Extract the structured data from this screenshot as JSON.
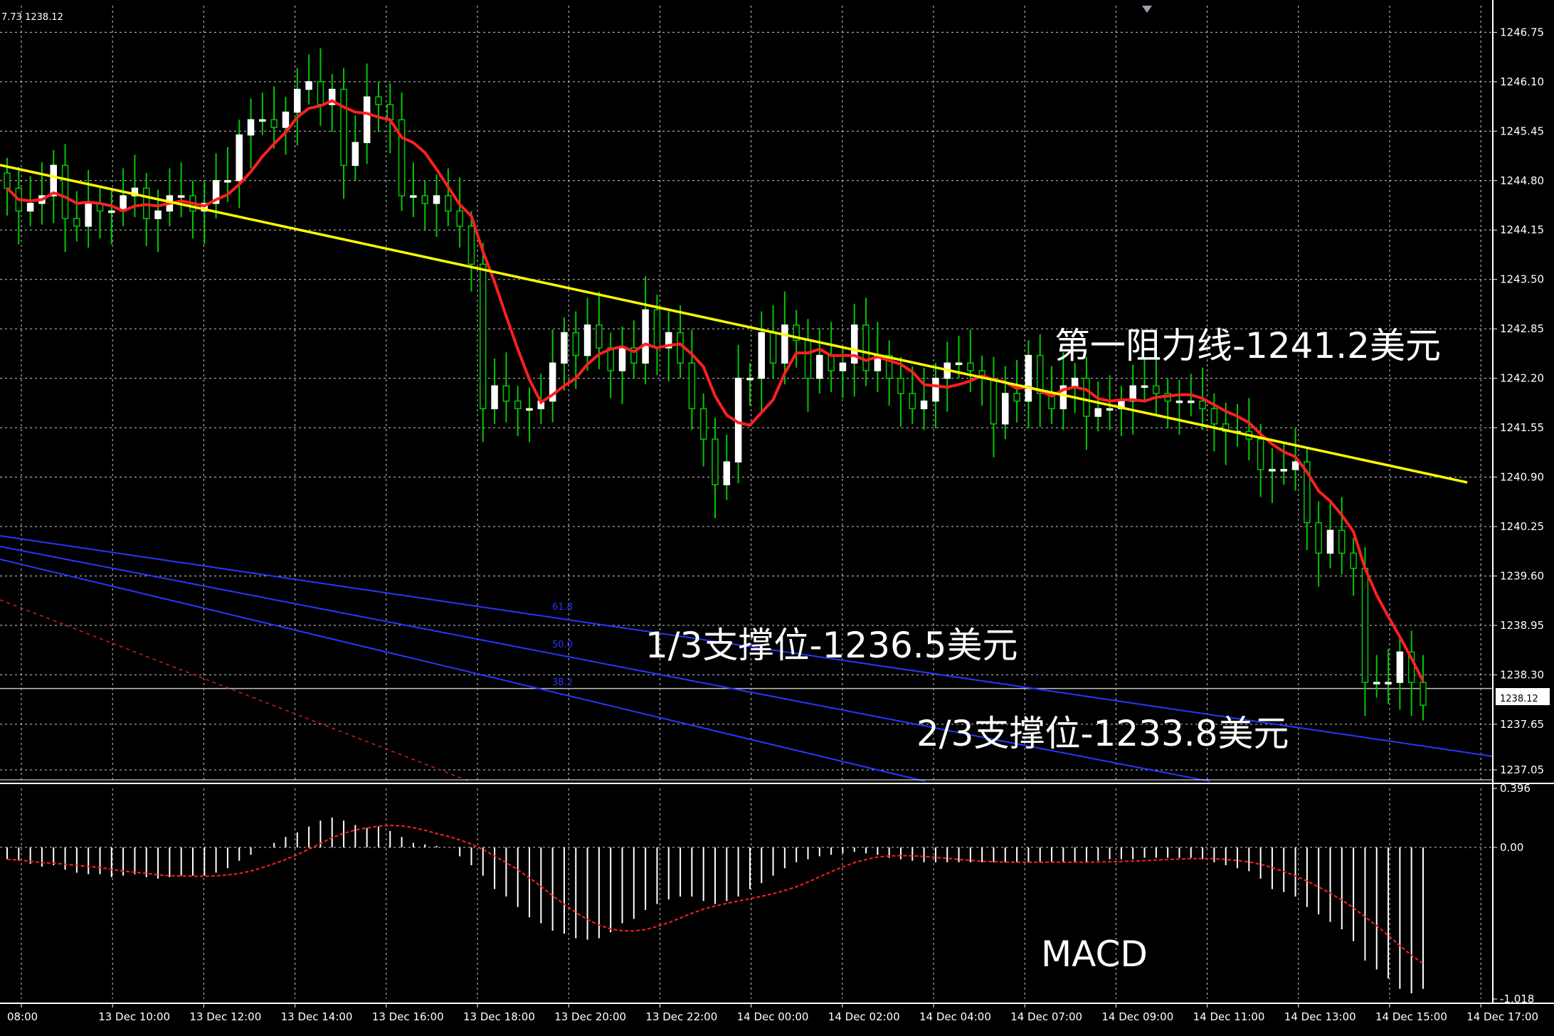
{
  "header": {
    "ohlc_text": "7.73 1238.12"
  },
  "colors": {
    "background": "#000000",
    "grid": "#ffffff",
    "bull_candle": "#ffffff",
    "wick": "#00c800",
    "ma_line": "#ff2020",
    "trend_line": "#ffff00",
    "fib_lines": "#2a36ff",
    "macd_hist": "#ffffff",
    "macd_signal": "#ff2020"
  },
  "annotations": {
    "resistance": "第一阻力线-1241.2美元",
    "support1": "1/3支撑位-1236.5美元",
    "support2": "2/3支撑位-1233.8美元",
    "macd": "MACD"
  },
  "fib_labels": [
    "61.8",
    "50.0",
    "38.2"
  ],
  "current_price_label": "1238.12",
  "chart_data": [
    {
      "type": "candlestick",
      "title": "",
      "price_axis_ticks": [
        "1246.75",
        "1246.10",
        "1245.45",
        "1244.80",
        "1244.15",
        "1243.50",
        "1242.85",
        "1242.20",
        "1241.55",
        "1240.90",
        "1240.25",
        "1239.60",
        "1238.95",
        "1238.30",
        "1237.65",
        "1237.05"
      ],
      "time_axis_ticks": [
        "08:00",
        "13 Dec 10:00",
        "13 Dec 12:00",
        "13 Dec 14:00",
        "13 Dec 16:00",
        "13 Dec 18:00",
        "13 Dec 20:00",
        "13 Dec 22:00",
        "14 Dec 00:00",
        "14 Dec 02:00",
        "14 Dec 04:00",
        "14 Dec 07:00",
        "14 Dec 09:00",
        "14 Dec 11:00",
        "14 Dec 13:00",
        "14 Dec 15:00",
        "14 Dec 17:00"
      ],
      "ylim": [
        1236.9,
        1247.1
      ],
      "last_price": 1238.12,
      "close": [
        1244.7,
        1244.4,
        1244.5,
        1244.6,
        1245.0,
        1244.3,
        1244.2,
        1244.5,
        1244.4,
        1244.4,
        1244.6,
        1244.7,
        1244.3,
        1244.4,
        1244.6,
        1244.6,
        1244.4,
        1244.5,
        1244.8,
        1244.8,
        1245.4,
        1245.6,
        1245.6,
        1245.5,
        1245.7,
        1246.0,
        1246.1,
        1245.8,
        1246.0,
        1245.0,
        1245.3,
        1245.9,
        1245.8,
        1245.6,
        1244.6,
        1244.6,
        1244.5,
        1244.6,
        1244.4,
        1244.2,
        1243.7,
        1241.8,
        1242.1,
        1241.9,
        1241.8,
        1241.8,
        1241.9,
        1242.4,
        1242.8,
        1242.5,
        1242.9,
        1242.6,
        1242.3,
        1242.6,
        1242.4,
        1243.1,
        1242.6,
        1242.8,
        1242.4,
        1241.8,
        1241.4,
        1240.8,
        1241.1,
        1242.2,
        1242.2,
        1242.8,
        1242.4,
        1242.9,
        1242.7,
        1242.2,
        1242.5,
        1242.3,
        1242.4,
        1242.9,
        1242.3,
        1242.5,
        1242.2,
        1242.0,
        1241.8,
        1241.9,
        1242.2,
        1242.4,
        1242.4,
        1242.3,
        1242.2,
        1241.6,
        1242.0,
        1241.9,
        1242.5,
        1242.0,
        1241.8,
        1242.1,
        1242.2,
        1241.7,
        1241.8,
        1241.8,
        1241.9,
        1242.1,
        1242.1,
        1242.0,
        1241.9,
        1241.9,
        1241.9,
        1241.8,
        1241.6,
        1241.5,
        1241.5,
        1241.4,
        1241.0,
        1241.0,
        1241.0,
        1241.1,
        1240.3,
        1239.9,
        1240.2,
        1239.9,
        1239.7,
        1238.2,
        1238.2,
        1238.2,
        1238.6,
        1238.2,
        1237.9
      ]
    },
    {
      "type": "bar",
      "title": "",
      "ylabel": "MACD",
      "y_axis_ticks": [
        "0.396",
        "0.00",
        "-1.018"
      ],
      "ylim": [
        -1.018,
        0.396
      ],
      "series": [
        {
          "values": [
            -0.08,
            -0.09,
            -0.11,
            -0.13,
            -0.12,
            -0.15,
            -0.17,
            -0.18,
            -0.18,
            -0.2,
            -0.19,
            -0.18,
            -0.2,
            -0.21,
            -0.2,
            -0.19,
            -0.19,
            -0.19,
            -0.17,
            -0.14,
            -0.09,
            -0.05,
            0.0,
            0.03,
            0.07,
            0.1,
            0.14,
            0.18,
            0.2,
            0.18,
            0.15,
            0.13,
            0.14,
            0.11,
            0.07,
            0.03,
            0.02,
            0.01,
            0.0,
            -0.06,
            -0.12,
            -0.19,
            -0.28,
            -0.33,
            -0.4,
            -0.47,
            -0.51,
            -0.56,
            -0.58,
            -0.61,
            -0.62,
            -0.61,
            -0.57,
            -0.51,
            -0.48,
            -0.42,
            -0.38,
            -0.35,
            -0.33,
            -0.33,
            -0.36,
            -0.38,
            -0.36,
            -0.33,
            -0.28,
            -0.24,
            -0.19,
            -0.14,
            -0.1,
            -0.08,
            -0.06,
            -0.05,
            -0.04,
            -0.03,
            -0.04,
            -0.05,
            -0.07,
            -0.08,
            -0.09,
            -0.1,
            -0.1,
            -0.1,
            -0.1,
            -0.1,
            -0.1,
            -0.1,
            -0.1,
            -0.1,
            -0.1,
            -0.1,
            -0.1,
            -0.1,
            -0.1,
            -0.1,
            -0.09,
            -0.08,
            -0.08,
            -0.08,
            -0.07,
            -0.07,
            -0.07,
            -0.07,
            -0.07,
            -0.08,
            -0.1,
            -0.12,
            -0.14,
            -0.16,
            -0.21,
            -0.28,
            -0.3,
            -0.33,
            -0.4,
            -0.45,
            -0.5,
            -0.55,
            -0.63,
            -0.76,
            -0.82,
            -0.88,
            -0.95,
            -0.98,
            -0.95
          ]
        }
      ]
    }
  ]
}
